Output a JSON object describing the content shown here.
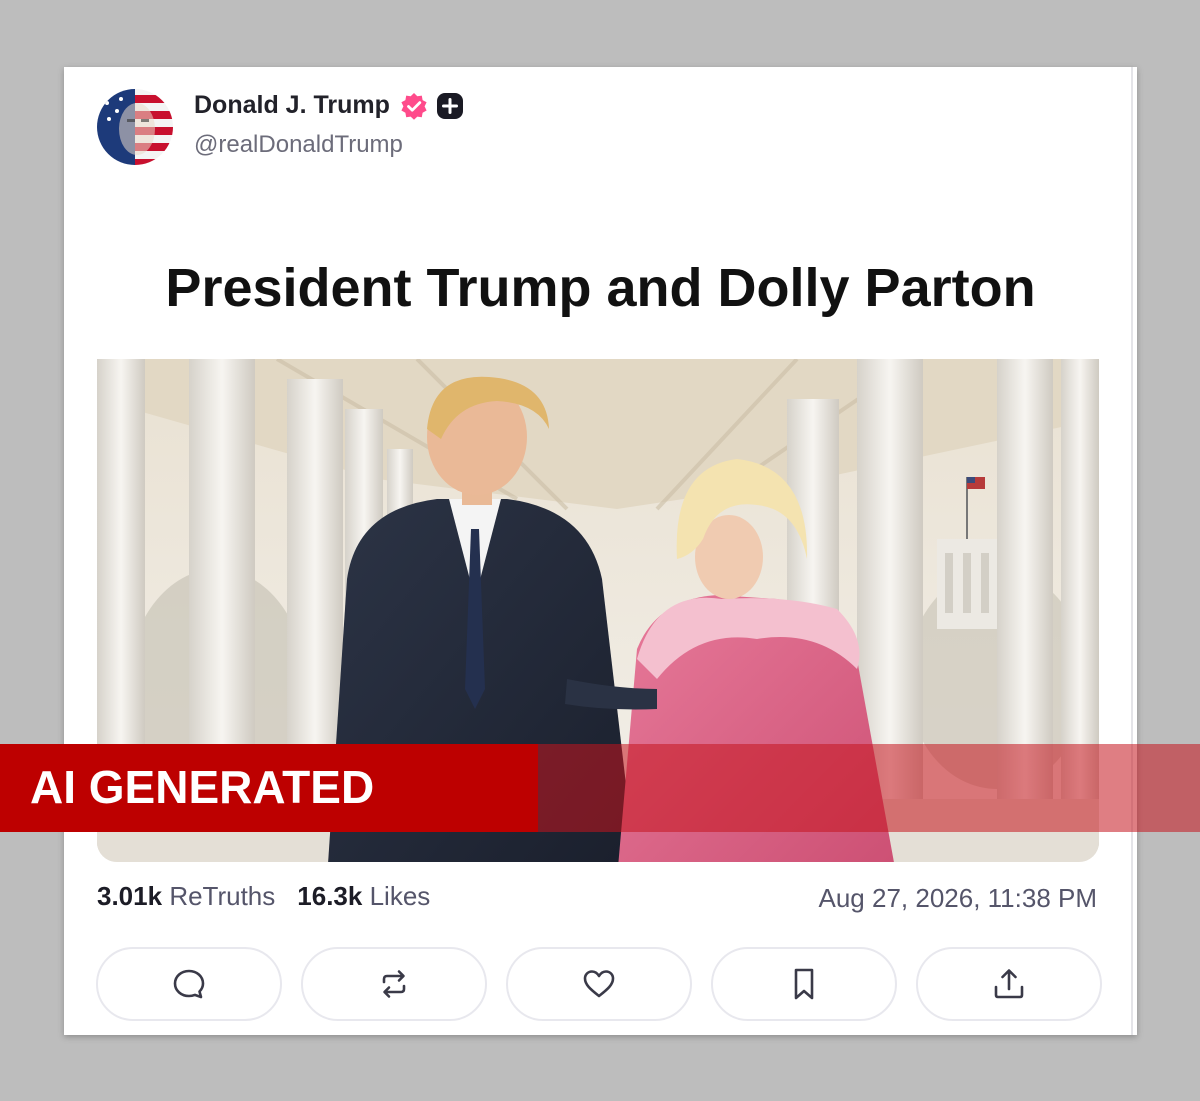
{
  "post": {
    "author_name": "Donald J. Trump",
    "handle": "@realDonaldTrump",
    "verified_icon": "verified-badge-icon",
    "title": "President Trump and Dolly Parton",
    "image_alt": "Watercolor illustration of two people walking arm in arm along a white colonnade",
    "stats": {
      "retruths_count": "3.01k",
      "retruths_label": "ReTruths",
      "likes_count": "16.3k",
      "likes_label": "Likes"
    },
    "timestamp": "Aug 27, 2026, 11:38 PM"
  },
  "actions": [
    {
      "name": "reply",
      "icon": "speech-bubble-icon"
    },
    {
      "name": "retruth",
      "icon": "repost-icon"
    },
    {
      "name": "like",
      "icon": "heart-icon"
    },
    {
      "name": "bookmark",
      "icon": "bookmark-icon"
    },
    {
      "name": "share",
      "icon": "share-upload-icon"
    }
  ],
  "overlay": {
    "label": "AI GENERATED"
  },
  "colors": {
    "background": "#bdbdbd",
    "card": "#ffffff",
    "verified_badge": "#ff4b8b",
    "banner_red": "#bd0000",
    "text_primary": "#1c1c26",
    "text_secondary": "#55556a"
  }
}
